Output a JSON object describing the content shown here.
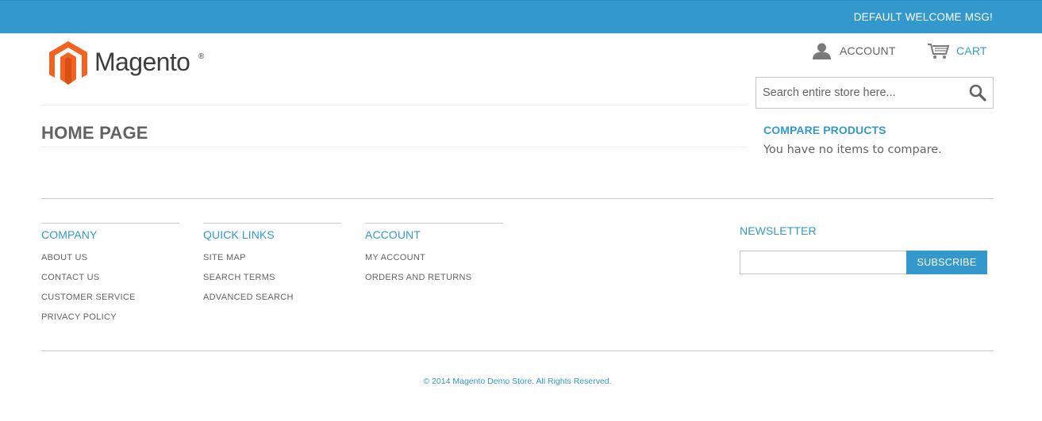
{
  "header": {
    "welcome_msg": "DEFAULT WELCOME MSG!",
    "logo_text": "Magento",
    "logo_reg": "®",
    "account_label": "ACCOUNT",
    "cart_label": "CART",
    "search_placeholder": "Search entire store here..."
  },
  "main": {
    "page_title": "HOME PAGE"
  },
  "sidebar": {
    "compare_title": "COMPARE PRODUCTS",
    "compare_empty": "You have no items to compare."
  },
  "footer": {
    "columns": [
      {
        "title": "COMPANY",
        "links": [
          "ABOUT US",
          "CONTACT US",
          "CUSTOMER SERVICE",
          "PRIVACY POLICY"
        ]
      },
      {
        "title": "QUICK LINKS",
        "links": [
          "SITE MAP",
          "SEARCH TERMS",
          "ADVANCED SEARCH"
        ]
      },
      {
        "title": "ACCOUNT",
        "links": [
          "MY ACCOUNT",
          "ORDERS AND RETURNS"
        ]
      }
    ],
    "newsletter_title": "NEWSLETTER",
    "subscribe_label": "SUBSCRIBE",
    "copyright": "© 2014 Magento Demo Store. All Rights Reserved."
  },
  "icons": {
    "account": "user-icon",
    "cart": "cart-icon",
    "search": "search-icon",
    "logo": "magento-logo-icon"
  },
  "colors": {
    "accent": "#3399cc",
    "logo_orange": "#f26322",
    "text": "#636363"
  }
}
